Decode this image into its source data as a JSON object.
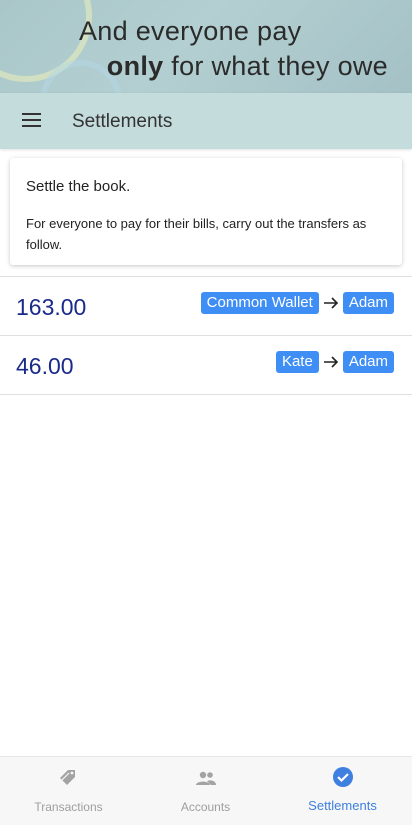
{
  "banner": {
    "line1": "And everyone pay",
    "line2_bold": "only",
    "line2_rest": " for what they owe"
  },
  "toolbar": {
    "menu_icon": "menu-icon",
    "title": "Settlements"
  },
  "info_card": {
    "title": "Settle the book.",
    "text": "For everyone to pay for their bills, carry out the transfers as follow."
  },
  "settlements": [
    {
      "amount": "163.00",
      "from": "Common Wallet",
      "to": "Adam"
    },
    {
      "amount": "46.00",
      "from": "Kate",
      "to": "Adam"
    }
  ],
  "nav": {
    "items": [
      {
        "label": "Transactions",
        "icon": "tag-icon",
        "active": false
      },
      {
        "label": "Accounts",
        "icon": "people-icon",
        "active": false
      },
      {
        "label": "Settlements",
        "icon": "check-circle-icon",
        "active": true
      }
    ]
  },
  "colors": {
    "accent": "#3f8ef5",
    "amount": "#1a2a8a",
    "active_nav": "#3f7fe0",
    "toolbar": "#c5dcdd"
  }
}
